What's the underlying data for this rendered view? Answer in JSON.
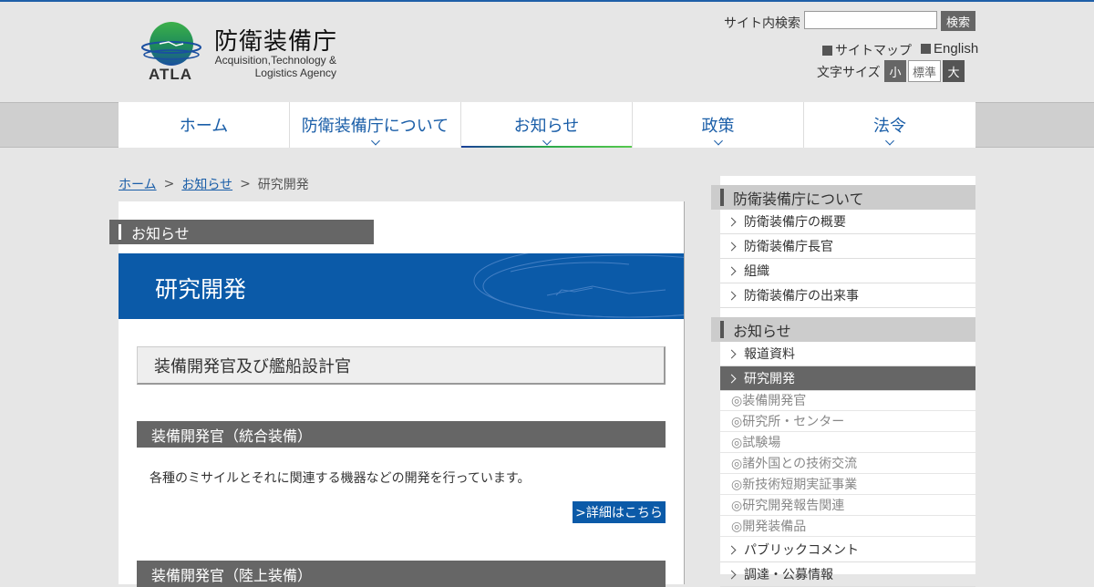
{
  "header": {
    "agency_name_ja": "防衛装備庁",
    "agency_abbr": "ATLA",
    "agency_name_en_line1": "Acquisition,Technology &",
    "agency_name_en_line2": "Logistics Agency",
    "search_label": "サイト内検索",
    "search_value": "",
    "search_button": "検索",
    "sitemap_label": "サイトマップ",
    "english_label": "English",
    "font_size_label": "文字サイズ",
    "font_small": "小",
    "font_standard": "標準",
    "font_large": "大"
  },
  "nav": {
    "items": [
      {
        "label": "ホーム"
      },
      {
        "label": "防衛装備庁について"
      },
      {
        "label": "お知らせ"
      },
      {
        "label": "政策"
      },
      {
        "label": "法令"
      }
    ]
  },
  "breadcrumb": {
    "home": "ホーム",
    "sep1": ">",
    "news": "お知らせ",
    "sep2": ">",
    "current": "研究開発"
  },
  "main": {
    "section_tag": "お知らせ",
    "hero_title": "研究開発",
    "heading": "装備開発官及び艦船設計官",
    "sections": [
      {
        "title": "装備開発官（統合装備）",
        "description": "各種のミサイルとそれに関連する機器などの開発を行っています。",
        "more": ">詳細はこちら"
      },
      {
        "title": "装備開発官（陸上装備）"
      }
    ]
  },
  "sidebar": {
    "group1_title": "防衛装備庁について",
    "group1_items": [
      "防衛装備庁の概要",
      "防衛装備庁長官",
      "組織",
      "防衛装備庁の出来事"
    ],
    "group2_title": "お知らせ",
    "group2_items": [
      "報道資料",
      "研究開発"
    ],
    "sub_items": [
      "◎装備開発官",
      "◎研究所・センター",
      "◎試験場",
      "◎諸外国との技術交流",
      "◎新技術短期実証事業",
      "◎研究開発報告関連",
      "◎開発装備品"
    ],
    "group2_more": [
      "パブリックコメント",
      "調達・公募情報"
    ]
  },
  "colors": {
    "brand_blue": "#0b5aa8",
    "link_blue": "#1a5ea8",
    "dark_gray": "#666666",
    "light_gray": "#e6e6e6"
  }
}
